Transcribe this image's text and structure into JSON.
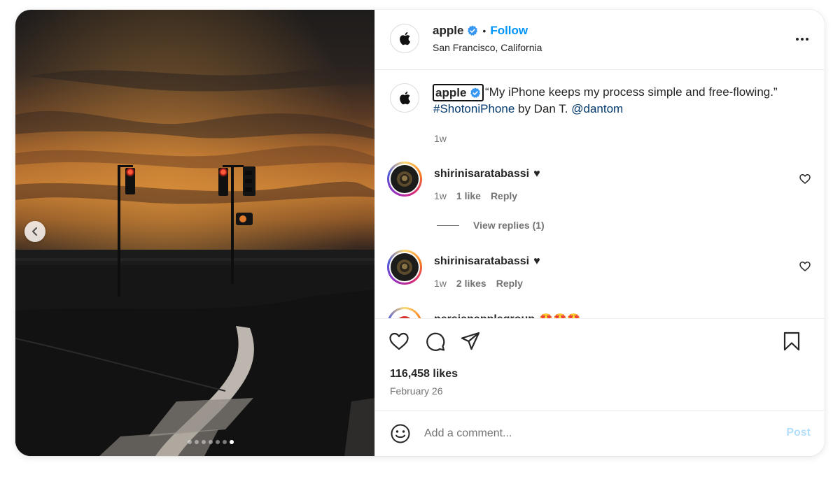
{
  "post": {
    "username": "apple",
    "follow_label": "Follow",
    "separator": "•",
    "location": "San Francisco, California",
    "caption_text": "“My iPhone keeps my process simple and free-flowing.”",
    "caption_hashtag": "#ShotoniPhone",
    "caption_by": " by Dan T. ",
    "caption_mention": "@dantom",
    "caption_time": "1w",
    "likes": "116,458 likes",
    "date": "February 26",
    "carousel": {
      "total": 7,
      "active_index": 6
    }
  },
  "comments": [
    {
      "username": "shirinisaratabassi",
      "emoji": "♥",
      "time": "1w",
      "likes": "1 like",
      "reply": "Reply"
    },
    {
      "username": "shirinisaratabassi",
      "emoji": "♥",
      "time": "1w",
      "likes": "2 likes",
      "reply": "Reply"
    },
    {
      "username": "persianapplegroup",
      "emoji": "🤩🤩🤩"
    }
  ],
  "view_replies": "View replies (1)",
  "comment_box": {
    "placeholder": "Add a comment...",
    "post_label": "Post"
  },
  "colors": {
    "link": "#0095f6",
    "hashtag": "#00376b",
    "muted": "#737373",
    "post_disabled": "#b2dffc"
  },
  "icons": [
    "chevron-left-icon",
    "verified-icon",
    "more-icon",
    "heart-icon",
    "comment-icon",
    "share-icon",
    "bookmark-icon",
    "emoji-icon",
    "apple-logo-icon"
  ]
}
